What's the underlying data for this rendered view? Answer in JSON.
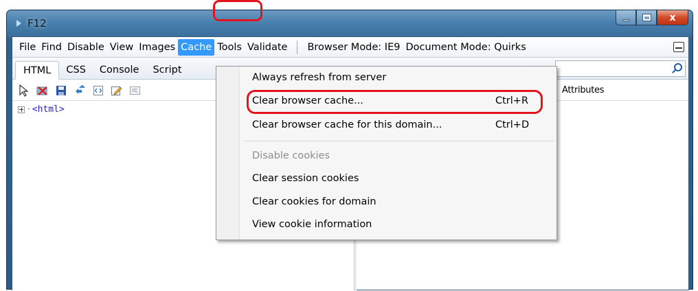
{
  "window": {
    "title": "F12",
    "close_glyph": "x"
  },
  "menubar": {
    "items": [
      "File",
      "Find",
      "Disable",
      "View",
      "Images",
      "Cache",
      "Tools",
      "Validate"
    ],
    "browser_mode": "Browser Mode: IE9",
    "document_mode": "Document Mode: Quirks"
  },
  "tabs": [
    "HTML",
    "CSS",
    "Console",
    "Script"
  ],
  "attributes_label": "Attributes",
  "tree": {
    "root_node": "<html>"
  },
  "dropdown": {
    "items": [
      {
        "label": "Always refresh from server",
        "shortcut": ""
      },
      {
        "label": "Clear browser cache...",
        "shortcut": "Ctrl+R"
      },
      {
        "label": "Clear browser cache for this domain...",
        "shortcut": "Ctrl+D"
      },
      {
        "label": "Disable cookies",
        "shortcut": ""
      },
      {
        "label": "Clear session cookies",
        "shortcut": ""
      },
      {
        "label": "Clear cookies for domain",
        "shortcut": ""
      },
      {
        "label": "View cookie information",
        "shortcut": ""
      }
    ]
  },
  "colors": {
    "menu_active": "#3399ff",
    "annotation_red": "#e4131c",
    "titlebar": "#4a80ad"
  },
  "icons": [
    "select-element-icon",
    "clear-icon",
    "save-icon",
    "refresh-icon",
    "source-icon",
    "edit-icon",
    "word-wrap-icon",
    "search-icon"
  ]
}
